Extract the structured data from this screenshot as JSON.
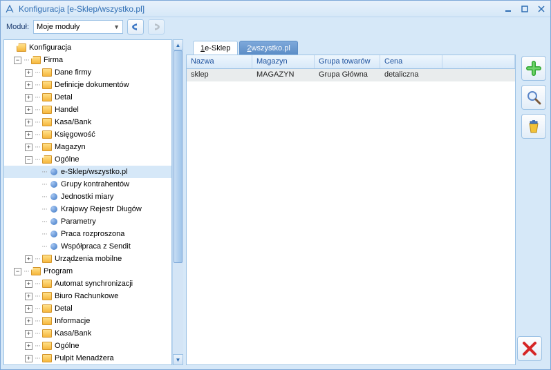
{
  "window": {
    "title": "Konfiguracja [e-Sklep/wszystko.pl]",
    "modul_label": "Moduł:",
    "modul_value": "Moje moduły"
  },
  "tree": {
    "root": "Konfiguracja",
    "firma": {
      "label": "Firma",
      "children": {
        "dane_firmy": "Dane firmy",
        "definicje": "Definicje dokumentów",
        "detal": "Detal",
        "handel": "Handel",
        "kasabank": "Kasa/Bank",
        "ksiegowosc": "Księgowość",
        "magazyn": "Magazyn",
        "ogolne": {
          "label": "Ogólne",
          "children": {
            "esklep": "e-Sklep/wszystko.pl",
            "grupy": "Grupy kontrahentów",
            "jednostki": "Jednostki miary",
            "krd": "Krajowy Rejestr Długów",
            "parametry": "Parametry",
            "praca": "Praca rozproszona",
            "sendit": "Współpraca z Sendit"
          }
        },
        "urzadzenia": "Urządzenia mobilne"
      }
    },
    "program": {
      "label": "Program",
      "children": {
        "automat": "Automat synchronizacji",
        "biuro": "Biuro Rachunkowe",
        "detal": "Detal",
        "informacje": "Informacje",
        "kasabank": "Kasa/Bank",
        "ogolne": "Ogólne",
        "pulpit": "Pulpit Menadżera"
      }
    }
  },
  "tabs": {
    "tab1_num": "1",
    "tab1_label": " e-Sklep",
    "tab2_num": "2",
    "tab2_label": " wszystko.pl"
  },
  "grid": {
    "headers": {
      "c1": "Nazwa",
      "c2": "Magazyn",
      "c3": "Grupa towarów",
      "c4": "Cena"
    },
    "row1": {
      "c1": "sklep",
      "c2": "MAGAZYN",
      "c3": "Grupa Główna",
      "c4": "detaliczna"
    }
  }
}
